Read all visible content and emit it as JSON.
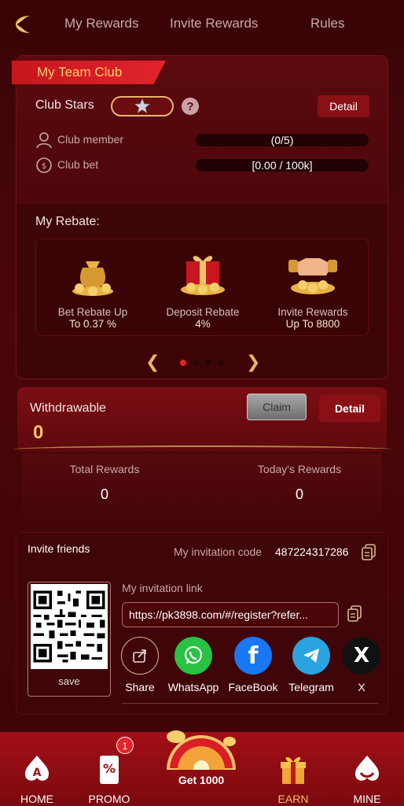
{
  "tabs": [
    "My Rewards",
    "Invite Rewards",
    "Rules"
  ],
  "club": {
    "tag": "My Team Club",
    "stars_label": "Club Stars",
    "detail": "Detail",
    "member_label": "Club member",
    "member_value": "(0/5)",
    "bet_label": "Club bet",
    "bet_value": "[0.00 / 100k]"
  },
  "rebate": {
    "title": "My Rebate:",
    "items": [
      {
        "line1": "Bet Rebate Up",
        "line2": "To 0.37 %"
      },
      {
        "line1": "Deposit Rebate",
        "line2": "4%"
      },
      {
        "line1": "Invite Rewards",
        "line2": "Up To 8800"
      }
    ]
  },
  "withdraw": {
    "label": "Withdrawable",
    "amount": "0",
    "claim": "Claim",
    "detail": "Detail"
  },
  "rewards": {
    "total_label": "Total Rewards",
    "total_value": "0",
    "today_label": "Today's Rewards",
    "today_value": "0"
  },
  "invite": {
    "title": "Invite friends",
    "code_label": "My invitation code",
    "code_value": "487224317286",
    "save": "save",
    "link_label": "My invitation link",
    "link_value": "https://pk3898.com/#/register?refer...",
    "share": [
      {
        "label": "Share",
        "icon": "share-icon"
      },
      {
        "label": "WhatsApp",
        "icon": "whatsapp-icon"
      },
      {
        "label": "FaceBook",
        "icon": "facebook-icon"
      },
      {
        "label": "Telegram",
        "icon": "telegram-icon"
      },
      {
        "label": "X",
        "icon": "x-icon"
      }
    ]
  },
  "nav": {
    "home": "HOME",
    "promo": "PROMO",
    "promo_badge": "1",
    "get": "Get 1000",
    "earn": "EARN",
    "mine": "MINE"
  },
  "colors": {
    "accent_red": "#e2242c",
    "gold": "#f0c36a",
    "background": "#3a0508"
  }
}
